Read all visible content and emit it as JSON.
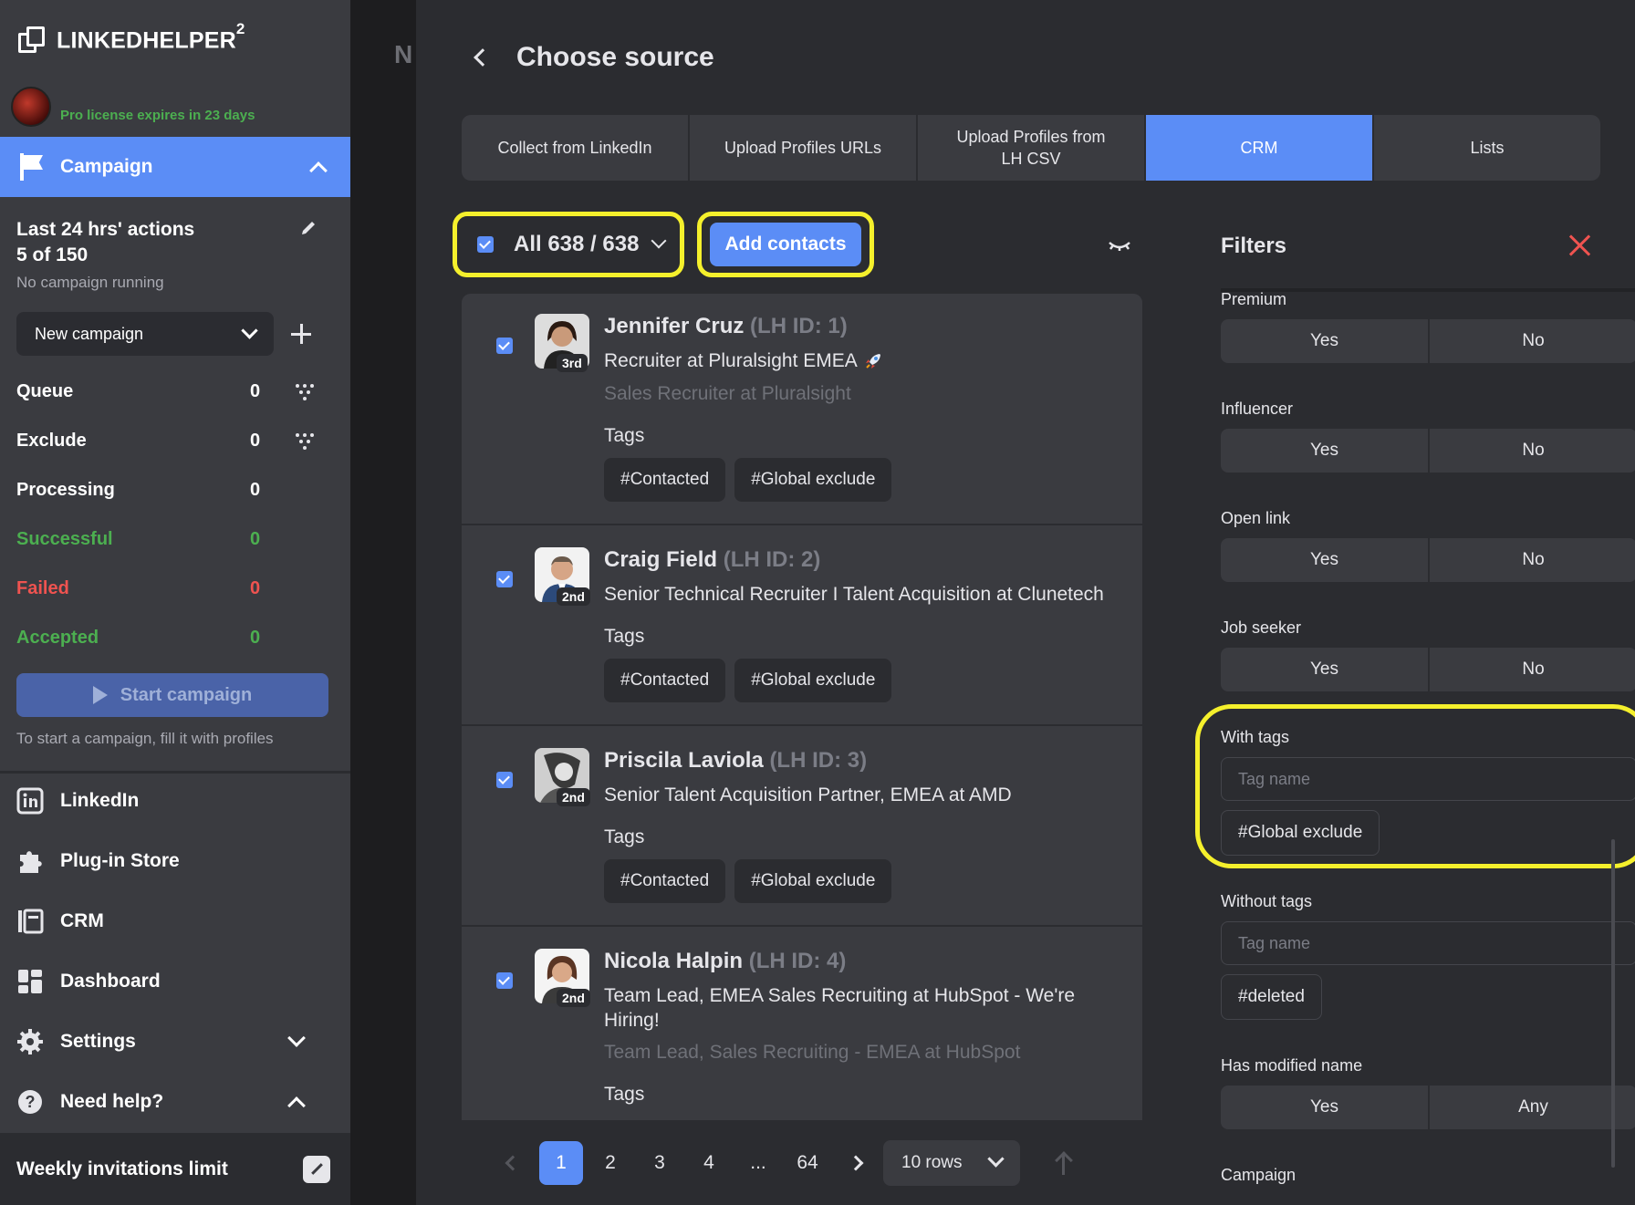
{
  "sidebar": {
    "brand": "LINKEDHELPER",
    "brand_sup": "2",
    "license": "Pro license expires in 23 days",
    "campaign_label": "Campaign",
    "actions_title": "Last 24 hrs' actions",
    "actions_count": "5 of 150",
    "actions_status": "No campaign running",
    "new_campaign": "New campaign",
    "stats": [
      {
        "label": "Queue",
        "value": "0"
      },
      {
        "label": "Exclude",
        "value": "0"
      },
      {
        "label": "Processing",
        "value": "0"
      },
      {
        "label": "Successful",
        "value": "0"
      },
      {
        "label": "Failed",
        "value": "0"
      },
      {
        "label": "Accepted",
        "value": "0"
      }
    ],
    "start_button": "Start campaign",
    "start_hint": "To start a campaign, fill it with profiles",
    "nav": [
      {
        "label": "LinkedIn",
        "icon": "linkedin-icon"
      },
      {
        "label": "Plug-in Store",
        "icon": "puzzle-icon"
      },
      {
        "label": "CRM",
        "icon": "crm-icon"
      },
      {
        "label": "Dashboard",
        "icon": "dashboard-icon"
      },
      {
        "label": "Settings",
        "icon": "gear-icon"
      },
      {
        "label": "Need help?",
        "icon": "question-icon"
      }
    ],
    "weekly_limit": "Weekly invitations limit"
  },
  "background": {
    "letter": "N"
  },
  "modal": {
    "title": "Choose source",
    "tabs": [
      {
        "label": "Collect from LinkedIn"
      },
      {
        "label": "Upload Profiles URLs"
      },
      {
        "label": "Upload Profiles from LH CSV"
      },
      {
        "label": "CRM"
      },
      {
        "label": "Lists"
      }
    ],
    "active_tab": "CRM",
    "select_all": "All 638 / 638",
    "add_contacts": "Add contacts"
  },
  "profiles": [
    {
      "name": "Jennifer Cruz",
      "lhid": "(LH ID: 1)",
      "degree": "3rd",
      "headline": "Recruiter at Pluralsight EMEA",
      "subtitle": "Sales Recruiter at Pluralsight",
      "tags_label": "Tags",
      "tags": [
        "#Contacted",
        "#Global exclude"
      ]
    },
    {
      "name": "Craig Field",
      "lhid": "(LH ID: 2)",
      "degree": "2nd",
      "headline": "Senior Technical Recruiter I Talent Acquisition at Clunetech",
      "subtitle": "",
      "tags_label": "Tags",
      "tags": [
        "#Contacted",
        "#Global exclude"
      ]
    },
    {
      "name": "Priscila Laviola",
      "lhid": "(LH ID: 3)",
      "degree": "2nd",
      "headline": "Senior Talent Acquisition Partner, EMEA at AMD",
      "subtitle": "",
      "tags_label": "Tags",
      "tags": [
        "#Contacted",
        "#Global exclude"
      ]
    },
    {
      "name": "Nicola Halpin",
      "lhid": "(LH ID: 4)",
      "degree": "2nd",
      "headline": "Team Lead, EMEA Sales Recruiting at HubSpot - We're Hiring!",
      "subtitle": "Team Lead, Sales Recruiting - EMEA at HubSpot",
      "tags_label": "Tags",
      "tags": []
    }
  ],
  "pagination": {
    "pages": [
      "1",
      "2",
      "3",
      "4",
      "...",
      "64"
    ],
    "active": "1",
    "rows": "10 rows"
  },
  "filters": {
    "title": "Filters",
    "premium": {
      "label": "Premium",
      "yes": "Yes",
      "no": "No"
    },
    "influencer": {
      "label": "Influencer",
      "yes": "Yes",
      "no": "No"
    },
    "open_link": {
      "label": "Open link",
      "yes": "Yes",
      "no": "No"
    },
    "job_seeker": {
      "label": "Job seeker",
      "yes": "Yes",
      "no": "No"
    },
    "with_tags": {
      "label": "With tags",
      "placeholder": "Tag name",
      "tag": "#Global exclude"
    },
    "without_tags": {
      "label": "Without tags",
      "placeholder": "Tag name",
      "tag": "#deleted"
    },
    "modified_name": {
      "label": "Has modified name",
      "yes": "Yes",
      "any": "Any"
    },
    "campaign": {
      "label": "Campaign"
    }
  }
}
